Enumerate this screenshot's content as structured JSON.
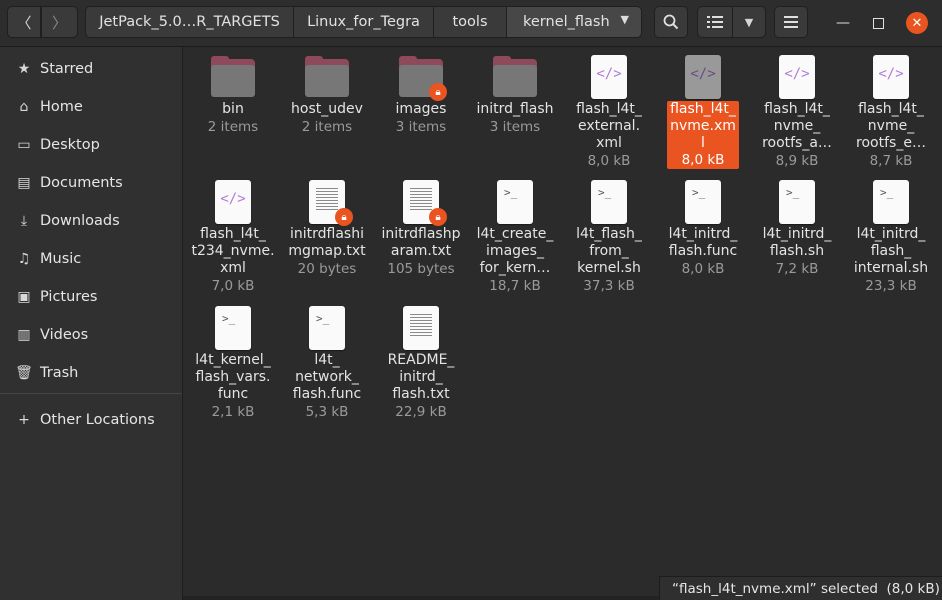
{
  "breadcrumbs": [
    "JetPack_5.0…R_TARGETS",
    "Linux_for_Tegra",
    "tools",
    "kernel_flash"
  ],
  "sidebar": {
    "items": [
      {
        "label": "Starred",
        "icon": "star-icon"
      },
      {
        "label": "Home",
        "icon": "home-icon"
      },
      {
        "label": "Desktop",
        "icon": "desktop-icon"
      },
      {
        "label": "Documents",
        "icon": "documents-icon"
      },
      {
        "label": "Downloads",
        "icon": "downloads-icon"
      },
      {
        "label": "Music",
        "icon": "music-icon"
      },
      {
        "label": "Pictures",
        "icon": "pictures-icon"
      },
      {
        "label": "Videos",
        "icon": "videos-icon"
      },
      {
        "label": "Trash",
        "icon": "trash-icon"
      }
    ],
    "other_locations": "Other Locations"
  },
  "files": [
    {
      "name": "bin",
      "meta": "2 items",
      "kind": "folder",
      "locked": false
    },
    {
      "name": "host_udev",
      "meta": "2 items",
      "kind": "folder",
      "locked": false
    },
    {
      "name": "images",
      "meta": "3 items",
      "kind": "folder",
      "locked": true
    },
    {
      "name": "initrd_flash",
      "meta": "3 items",
      "kind": "folder",
      "locked": false
    },
    {
      "name": "flash_l4t_\nexternal.\nxml",
      "meta": "8,0 kB",
      "kind": "xml",
      "locked": false
    },
    {
      "name": "flash_l4t_\nnvme.xml",
      "meta": "8,0 kB",
      "kind": "xml",
      "locked": false,
      "selected": true
    },
    {
      "name": "flash_l4t_\nnvme_\nrootfs_a…",
      "meta": "8,9 kB",
      "kind": "xml",
      "locked": false
    },
    {
      "name": "flash_l4t_\nnvme_\nrootfs_e…",
      "meta": "8,7 kB",
      "kind": "xml",
      "locked": false
    },
    {
      "name": "flash_l4t_\nt234_nvme.\nxml",
      "meta": "7,0 kB",
      "kind": "xml",
      "locked": false
    },
    {
      "name": "initrdflashi\nmgmap.txt",
      "meta": "20 bytes",
      "kind": "text",
      "locked": true
    },
    {
      "name": "initrdflashp\naram.txt",
      "meta": "105 bytes",
      "kind": "text",
      "locked": true
    },
    {
      "name": "l4t_create_\nimages_\nfor_kern…",
      "meta": "18,7 kB",
      "kind": "script",
      "locked": false
    },
    {
      "name": "l4t_flash_\nfrom_\nkernel.sh",
      "meta": "37,3 kB",
      "kind": "script",
      "locked": false
    },
    {
      "name": "l4t_initrd_\nflash.func",
      "meta": "8,0 kB",
      "kind": "script",
      "locked": false
    },
    {
      "name": "l4t_initrd_\nflash.sh",
      "meta": "7,2 kB",
      "kind": "script",
      "locked": false
    },
    {
      "name": "l4t_initrd_\nflash_\ninternal.sh",
      "meta": "23,3 kB",
      "kind": "script",
      "locked": false
    },
    {
      "name": "l4t_kernel_\nflash_vars.\nfunc",
      "meta": "2,1 kB",
      "kind": "script",
      "locked": false
    },
    {
      "name": "l4t_\nnetwork_\nflash.func",
      "meta": "5,3 kB",
      "kind": "script",
      "locked": false
    },
    {
      "name": "README_\ninitrd_\nflash.txt",
      "meta": "22,9 kB",
      "kind": "text",
      "locked": false
    }
  ],
  "status": "“flash_l4t_nvme.xml” selected  (8,0 kB)",
  "colors": {
    "accent": "#e95420",
    "background": "#2b2b2b",
    "sidebar": "#303030"
  }
}
